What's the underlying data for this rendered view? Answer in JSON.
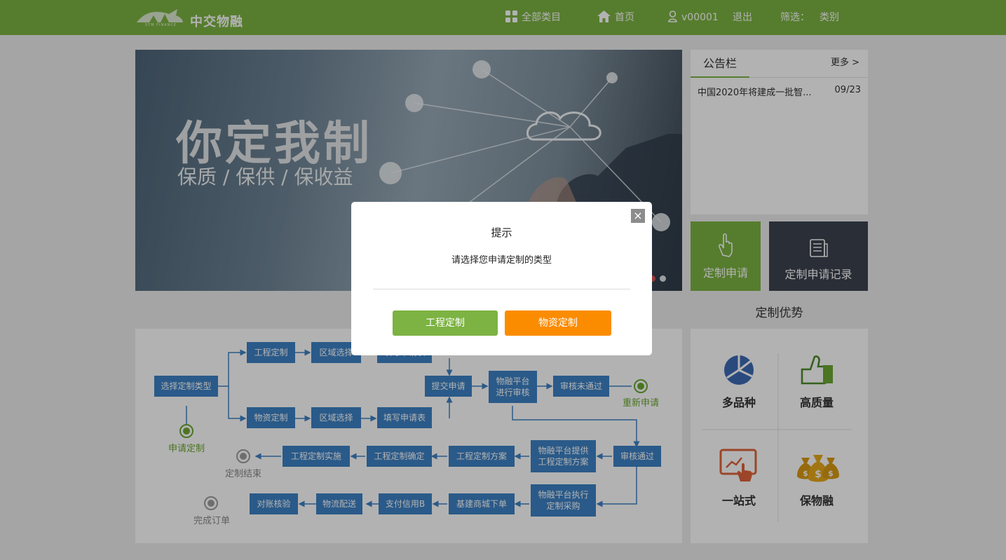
{
  "header": {
    "brand": "中交物融",
    "brand_sub": "STM FINANCE",
    "nav": {
      "all_categories": "全部类目",
      "home": "首页",
      "user": "v00001",
      "logout": "退出",
      "filter_label": "筛选：",
      "filter_value": "类别"
    }
  },
  "banner": {
    "title": "你定我制",
    "subtitle": "保质 / 保供 / 保收益"
  },
  "notice": {
    "tab": "公告栏",
    "more": "更多 >",
    "items": [
      {
        "title": "中国2020年将建成一批智...",
        "date": "09/23"
      }
    ]
  },
  "tiles": {
    "apply": "定制申请",
    "records": "定制申请记录"
  },
  "advantages": {
    "title": "定制优势",
    "items": [
      "多品种",
      "高质量",
      "一站式",
      "保物融"
    ]
  },
  "flow": {
    "boxes": {
      "select_type": "选择定制类型",
      "eng_custom": "工程定制",
      "region1": "区域选择",
      "fill1": "填写申请表",
      "mat_custom": "物资定制",
      "region2": "区域选择",
      "fill2": "填写申请表",
      "submit": "提交申请",
      "review": "物融平台进行审核",
      "reject": "审核未通过",
      "approve": "审核通过",
      "provide_plan": "物融平台提供工程定制方案",
      "plan": "工程定制方案",
      "confirm": "工程定制确定",
      "implement": "工程定制实施",
      "execute": "物融平台执行定制采购",
      "order": "基建商城下单",
      "pay": "支付信用B",
      "ship": "物流配送",
      "reconcile": "对账核验"
    },
    "labels": {
      "start": "申请定制",
      "reapply": "重新申请",
      "end_custom": "定制结束",
      "complete": "完成订单"
    }
  },
  "modal": {
    "close": "×",
    "title": "提示",
    "message": "请选择您申请定制的类型",
    "btn_engineering": "工程定制",
    "btn_material": "物资定制"
  },
  "colors": {
    "brand_green": "#7cb342",
    "flow_blue": "#3d82c4",
    "orange": "#fb8c00",
    "dark_tile": "#3c4250"
  }
}
